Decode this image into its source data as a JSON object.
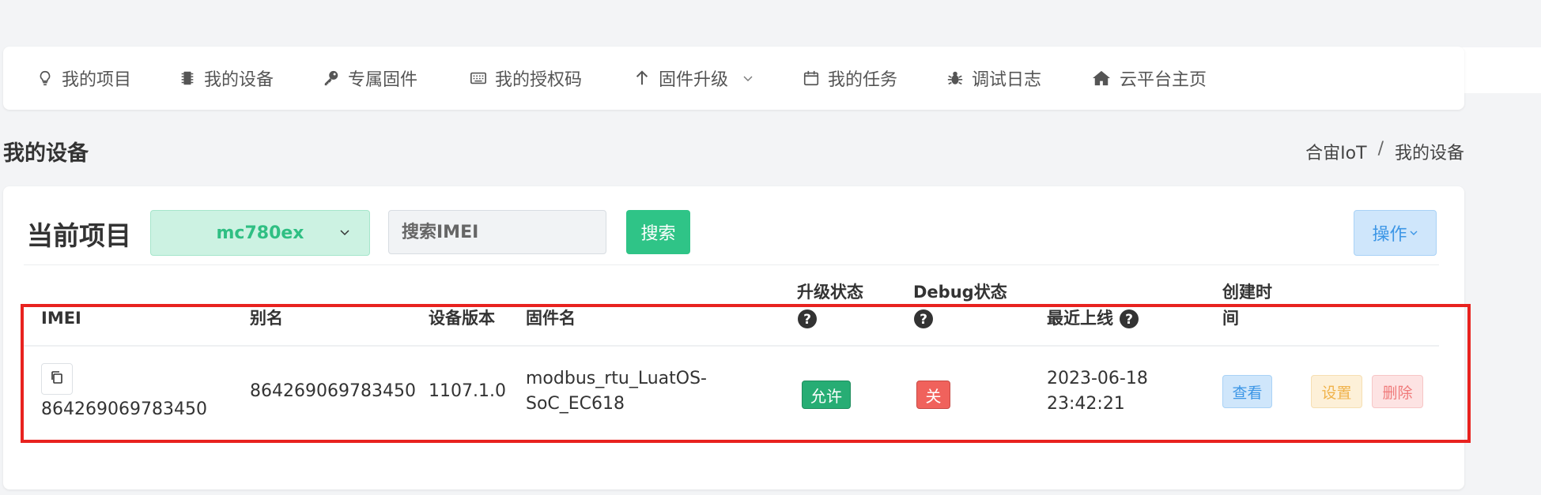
{
  "nav": {
    "items": [
      {
        "label": "我的项目",
        "icon": "lightbulb-icon"
      },
      {
        "label": "我的设备",
        "icon": "chip-icon"
      },
      {
        "label": "专属固件",
        "icon": "key-icon"
      },
      {
        "label": "我的授权码",
        "icon": "keyboard-icon"
      },
      {
        "label": "固件升级",
        "icon": "arrow-up-icon"
      },
      {
        "label": "我的任务",
        "icon": "calendar-icon"
      },
      {
        "label": "调试日志",
        "icon": "bug-icon"
      },
      {
        "label": "云平台主页",
        "icon": "home-icon"
      }
    ]
  },
  "page": {
    "title": "我的设备"
  },
  "breadcrumb": {
    "root": "合宙IoT",
    "sep": "/",
    "current": "我的设备"
  },
  "toolbar": {
    "project_label": "当前项目",
    "project_value": "mc780ex",
    "search_placeholder": "搜索IMEI",
    "search_button": "搜索",
    "ops_button": "操作"
  },
  "table": {
    "headers": {
      "imei": "IMEI",
      "alias": "别名",
      "version": "设备版本",
      "firmware": "固件名",
      "upgrade_status_line1": "升级状态",
      "debug_status_line1": "Debug状态",
      "last_online": "最近上线",
      "created_line1": "创建时",
      "created_line2": "间"
    },
    "rows": [
      {
        "imei": "864269069783450",
        "alias": "864269069783450",
        "version": "1107.1.0",
        "firmware_line1": "modbus_rtu_LuatOS-",
        "firmware_line2": "SoC_EC618",
        "upgrade_status": "允许",
        "debug_status": "关",
        "last_online_date": "2023-06-18",
        "last_online_time": "23:42:21",
        "actions": {
          "view": "查看",
          "settings": "设置",
          "delete": "删除"
        }
      }
    ]
  },
  "colors": {
    "accent_green": "#2fc487",
    "accent_blue": "#3c96e6",
    "highlight_red": "#e8221f"
  }
}
